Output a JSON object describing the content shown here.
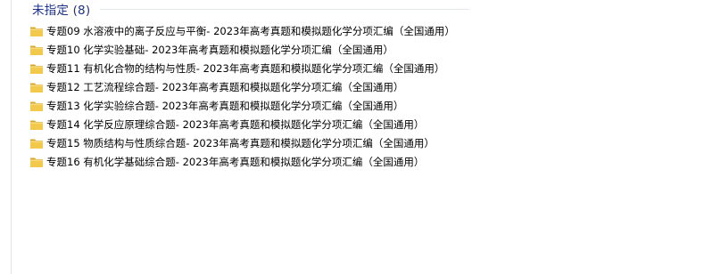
{
  "group": {
    "title": "未指定 (8)"
  },
  "files": [
    {
      "name": "专题09 水溶液中的离子反应与平衡- 2023年高考真题和模拟题化学分项汇编（全国通用）",
      "icon": "folder-icon"
    },
    {
      "name": "专题10 化学实验基础- 2023年高考真题和模拟题化学分项汇编（全国通用）",
      "icon": "folder-icon"
    },
    {
      "name": "专题11 有机化合物的结构与性质- 2023年高考真题和模拟题化学分项汇编（全国通用）",
      "icon": "folder-icon"
    },
    {
      "name": "专题12 工艺流程综合题- 2023年高考真题和模拟题化学分项汇编（全国通用）",
      "icon": "folder-icon"
    },
    {
      "name": "专题13 化学实验综合题- 2023年高考真题和模拟题化学分项汇编（全国通用）",
      "icon": "folder-icon"
    },
    {
      "name": "专题14 化学反应原理综合题- 2023年高考真题和模拟题化学分项汇编（全国通用）",
      "icon": "folder-icon"
    },
    {
      "name": "专题15 物质结构与性质综合题- 2023年高考真题和模拟题化学分项汇编（全国通用）",
      "icon": "folder-icon"
    },
    {
      "name": "专题16 有机化学基础综合题- 2023年高考真题和模拟题化学分项汇编（全国通用）",
      "icon": "folder-icon"
    }
  ],
  "colors": {
    "group_title": "#1e3287",
    "folder_front": "#f3c94c",
    "folder_back": "#d9a72e"
  }
}
